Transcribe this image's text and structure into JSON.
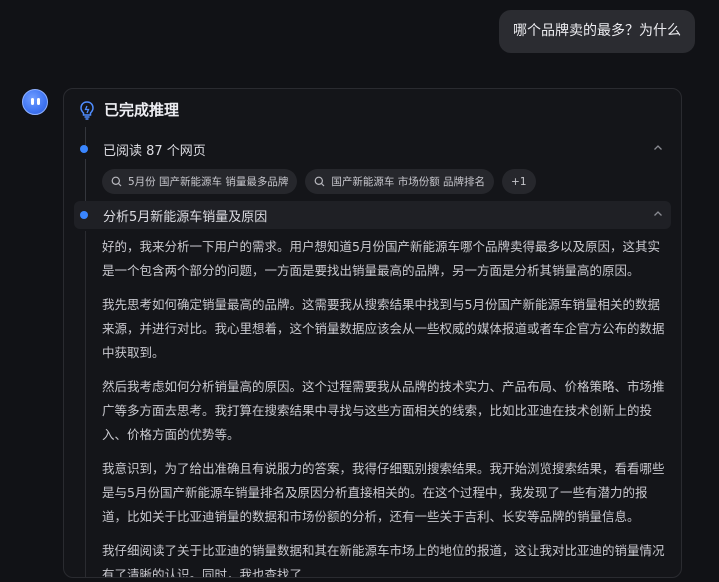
{
  "user_message": "哪个品牌卖的最多？为什么",
  "panel": {
    "title": "已完成推理",
    "steps": [
      {
        "label": "已阅读 87 个网页"
      },
      {
        "label": "分析5月新能源车销量及原因"
      }
    ],
    "chips": [
      {
        "icon": "search-icon",
        "label": "5月份 国产新能源车 销量最多品牌"
      },
      {
        "icon": "search-icon",
        "label": "国产新能源车 市场份额 品牌排名"
      },
      {
        "label": "+1"
      }
    ],
    "paragraphs": [
      "好的，我来分析一下用户的需求。用户想知道5月份国产新能源车哪个品牌卖得最多以及原因，这其实是一个包含两个部分的问题，一方面是要找出销量最高的品牌，另一方面是分析其销量高的原因。",
      "我先思考如何确定销量最高的品牌。这需要我从搜索结果中找到与5月份国产新能源车销量相关的数据来源，并进行对比。我心里想着，这个销量数据应该会从一些权威的媒体报道或者车企官方公布的数据中获取到。",
      "然后我考虑如何分析销量高的原因。这个过程需要我从品牌的技术实力、产品布局、价格策略、市场推广等多方面去思考。我打算在搜索结果中寻找与这些方面相关的线索，比如比亚迪在技术创新上的投入、价格方面的优势等。",
      "我意识到，为了给出准确且有说服力的答案，我得仔细甄别搜索结果。我开始浏览搜索结果，看看哪些是与5月份国产新能源车销量排名及原因分析直接相关的。在这个过程中，我发现了一些有潜力的报道，比如关于比亚迪销量的数据和市场份额的分析，还有一些关于吉利、长安等品牌的销量信息。",
      "我仔细阅读了关于比亚迪的销量数据和其在新能源车市场上的地位的报道，这让我对比亚迪的销量情况有了清晰的认识。同时，我也查找了"
    ]
  },
  "colors": {
    "accent": "#3a86ff",
    "background": "#111216"
  }
}
